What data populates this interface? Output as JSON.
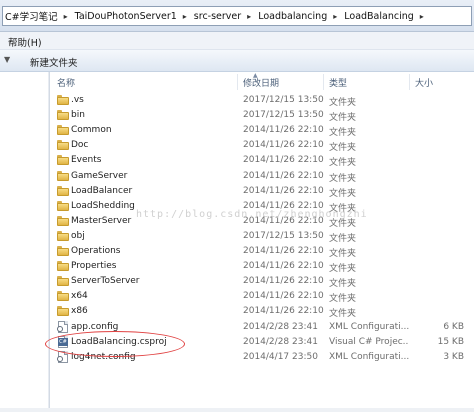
{
  "address_bar": {
    "crumbs": [
      "C#学习笔记",
      "TaiDouPhotonServer1",
      "src-server",
      "Loadbalancing",
      "LoadBalancing"
    ]
  },
  "menu": {
    "help": "帮助(H)"
  },
  "toolbar": {
    "new_folder": "新建文件夹"
  },
  "columns": {
    "name": "名称",
    "date": "修改日期",
    "type": "类型",
    "size": "大小"
  },
  "files": [
    {
      "name": ".vs",
      "date": "2017/12/15 13:50",
      "type": "文件夹",
      "size": "",
      "kind": "folder"
    },
    {
      "name": "bin",
      "date": "2017/12/15 13:50",
      "type": "文件夹",
      "size": "",
      "kind": "folder"
    },
    {
      "name": "Common",
      "date": "2014/11/26 22:10",
      "type": "文件夹",
      "size": "",
      "kind": "folder"
    },
    {
      "name": "Doc",
      "date": "2014/11/26 22:10",
      "type": "文件夹",
      "size": "",
      "kind": "folder"
    },
    {
      "name": "Events",
      "date": "2014/11/26 22:10",
      "type": "文件夹",
      "size": "",
      "kind": "folder"
    },
    {
      "name": "GameServer",
      "date": "2014/11/26 22:10",
      "type": "文件夹",
      "size": "",
      "kind": "folder"
    },
    {
      "name": "LoadBalancer",
      "date": "2014/11/26 22:10",
      "type": "文件夹",
      "size": "",
      "kind": "folder"
    },
    {
      "name": "LoadShedding",
      "date": "2014/11/26 22:10",
      "type": "文件夹",
      "size": "",
      "kind": "folder"
    },
    {
      "name": "MasterServer",
      "date": "2014/11/26 22:10",
      "type": "文件夹",
      "size": "",
      "kind": "folder"
    },
    {
      "name": "obj",
      "date": "2017/12/15 13:50",
      "type": "文件夹",
      "size": "",
      "kind": "folder"
    },
    {
      "name": "Operations",
      "date": "2014/11/26 22:10",
      "type": "文件夹",
      "size": "",
      "kind": "folder"
    },
    {
      "name": "Properties",
      "date": "2014/11/26 22:10",
      "type": "文件夹",
      "size": "",
      "kind": "folder"
    },
    {
      "name": "ServerToServer",
      "date": "2014/11/26 22:10",
      "type": "文件夹",
      "size": "",
      "kind": "folder"
    },
    {
      "name": "x64",
      "date": "2014/11/26 22:10",
      "type": "文件夹",
      "size": "",
      "kind": "folder"
    },
    {
      "name": "x86",
      "date": "2014/11/26 22:10",
      "type": "文件夹",
      "size": "",
      "kind": "folder"
    },
    {
      "name": "app.config",
      "date": "2014/2/28 23:41",
      "type": "XML Configurati...",
      "size": "6 KB",
      "kind": "config"
    },
    {
      "name": "LoadBalancing.csproj",
      "date": "2014/2/28 23:41",
      "type": "Visual C# Projec...",
      "size": "15 KB",
      "kind": "csproj"
    },
    {
      "name": "log4net.config",
      "date": "2014/4/17 23:50",
      "type": "XML Configurati...",
      "size": "3 KB",
      "kind": "config"
    }
  ],
  "watermark": "http://blog.csdn.net/zhenghongzhi",
  "annotation_color": "#e04040"
}
